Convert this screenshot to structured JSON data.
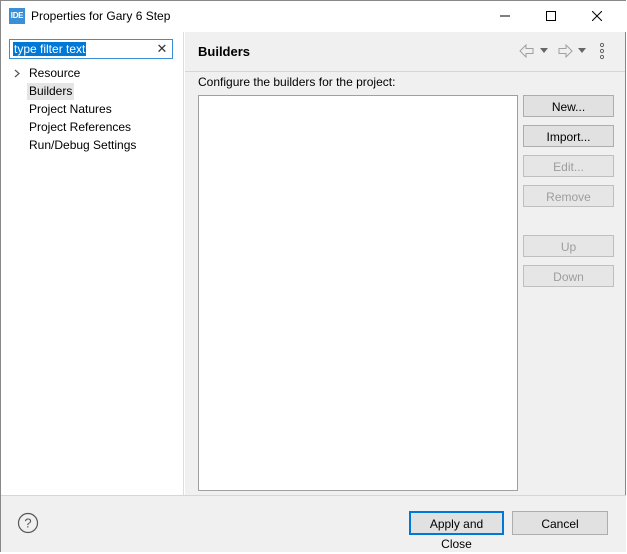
{
  "window": {
    "app_icon_label": "IDE",
    "title": "Properties for Gary 6 Step"
  },
  "filter": {
    "value": "type filter text",
    "clear_glyph": "✕"
  },
  "tree": {
    "items": [
      {
        "label": "Resource",
        "expandable": true,
        "selected": false
      },
      {
        "label": "Builders",
        "expandable": false,
        "selected": true
      },
      {
        "label": "Project Natures",
        "expandable": false,
        "selected": false
      },
      {
        "label": "Project References",
        "expandable": false,
        "selected": false
      },
      {
        "label": "Run/Debug Settings",
        "expandable": false,
        "selected": false
      }
    ]
  },
  "page": {
    "title": "Builders",
    "description": "Configure the builders for the project:",
    "builders": []
  },
  "buttons": {
    "new": "New...",
    "import": "Import...",
    "edit": "Edit...",
    "remove": "Remove",
    "up": "Up",
    "down": "Down"
  },
  "footer": {
    "apply_close": "Apply and Close",
    "cancel": "Cancel"
  },
  "colors": {
    "accent": "#0078d7",
    "selection": "#e5e5e5",
    "panel": "#f0f0f0"
  }
}
